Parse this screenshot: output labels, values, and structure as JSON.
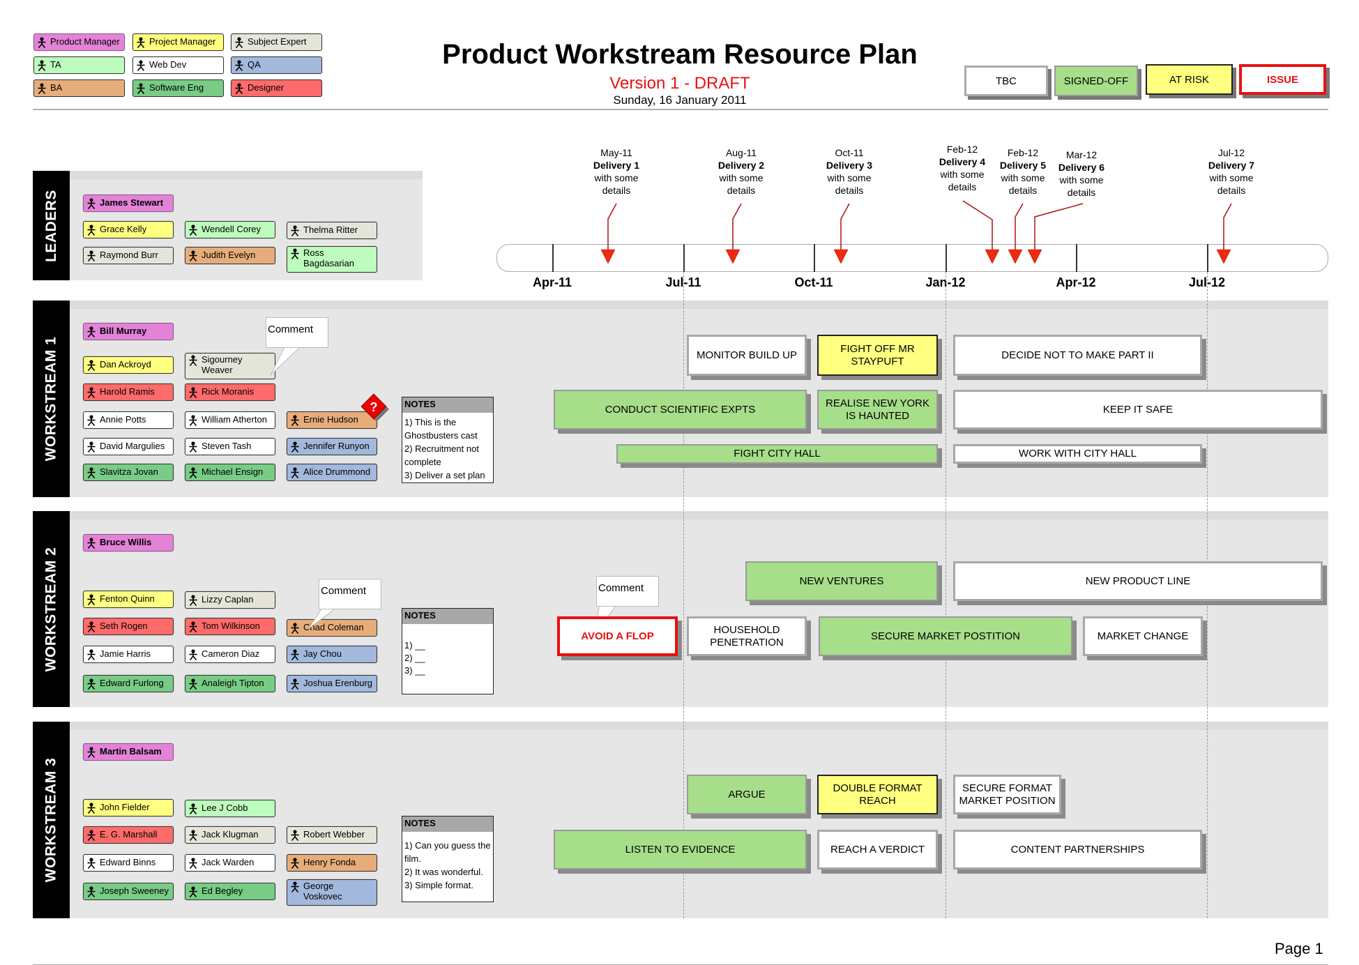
{
  "header": {
    "title": "Product Workstream Resource Plan",
    "version": "Version 1 - DRAFT",
    "date": "Sunday, 16 January 2011"
  },
  "role_legend": [
    {
      "label": "Product Manager",
      "role": "pm"
    },
    {
      "label": "Project Manager",
      "role": "prj"
    },
    {
      "label": "Subject Expert",
      "role": "sme"
    },
    {
      "label": "TA",
      "role": "ta"
    },
    {
      "label": "Web Dev",
      "role": "web"
    },
    {
      "label": "QA",
      "role": "qa"
    },
    {
      "label": "BA",
      "role": "ba"
    },
    {
      "label": "Software Eng",
      "role": "sw"
    },
    {
      "label": "Designer",
      "role": "des"
    }
  ],
  "status_legend": [
    {
      "label": "TBC",
      "status": "tbc"
    },
    {
      "label": "SIGNED-OFF",
      "status": "signed"
    },
    {
      "label": "AT RISK",
      "status": "risk"
    },
    {
      "label": "ISSUE",
      "status": "issue"
    }
  ],
  "timeline": {
    "ticks": [
      "Apr-11",
      "Jul-11",
      "Oct-11",
      "Jan-12",
      "Apr-12",
      "Jul-12"
    ],
    "milestones": [
      {
        "date": "May-11",
        "name": "Delivery 1",
        "detail": "with some details"
      },
      {
        "date": "Aug-11",
        "name": "Delivery 2",
        "detail": "with some details"
      },
      {
        "date": "Oct-11",
        "name": "Delivery 3",
        "detail": "with some details"
      },
      {
        "date": "Feb-12",
        "name": "Delivery 4",
        "detail": "with some details"
      },
      {
        "date": "Feb-12",
        "name": "Delivery 5",
        "detail": "with some details"
      },
      {
        "date": "Mar-12",
        "name": "Delivery 6",
        "detail": "with some details"
      },
      {
        "date": "Jul-12",
        "name": "Delivery 7",
        "detail": "with some details"
      }
    ]
  },
  "leaders": {
    "label": "LEADERS",
    "people": [
      {
        "name": "James Stewart",
        "role": "pm"
      },
      {
        "name": "Grace Kelly",
        "role": "prj"
      },
      {
        "name": "Wendell Corey",
        "role": "ta"
      },
      {
        "name": "Thelma Ritter",
        "role": "sme"
      },
      {
        "name": "Raymond Burr",
        "role": "sme"
      },
      {
        "name": "Judith Evelyn",
        "role": "ba"
      },
      {
        "name": "Ross Bagdasarian",
        "role": "ta"
      }
    ]
  },
  "workstreams": [
    {
      "label": "WORKSTREAM 1",
      "people": [
        {
          "name": "Bill Murray",
          "role": "pm"
        },
        {
          "name": "Dan Ackroyd",
          "role": "prj"
        },
        {
          "name": "Sigourney Weaver",
          "role": "sme"
        },
        {
          "name": "Harold Ramis",
          "role": "des"
        },
        {
          "name": "Rick Moranis",
          "role": "des"
        },
        {
          "name": "Annie Potts",
          "role": "web"
        },
        {
          "name": "William Atherton",
          "role": "web"
        },
        {
          "name": "Ernie Hudson",
          "role": "ba"
        },
        {
          "name": "David Margulies",
          "role": "web"
        },
        {
          "name": "Steven Tash",
          "role": "web"
        },
        {
          "name": "Jennifer Runyon",
          "role": "qa"
        },
        {
          "name": "Slavitza Jovan",
          "role": "sw"
        },
        {
          "name": "Michael Ensign",
          "role": "sw"
        },
        {
          "name": "Alice Drummond",
          "role": "qa"
        }
      ],
      "comment": "Comment",
      "flag": "?",
      "notes": {
        "title": "NOTES",
        "lines": [
          "1) This is the Ghostbusters cast",
          "2) Recruitment not complete",
          "3) Deliver a set plan"
        ]
      },
      "tasks": [
        {
          "label": "MONITOR BUILD UP",
          "status": "tbc"
        },
        {
          "label": "FIGHT OFF MR STAYPUFT",
          "status": "risk"
        },
        {
          "label": "DECIDE NOT TO MAKE PART II",
          "status": "tbc"
        },
        {
          "label": "CONDUCT SCIENTIFIC EXPTS",
          "status": "signed"
        },
        {
          "label": "REALISE NEW YORK IS HAUNTED",
          "status": "signed"
        },
        {
          "label": "KEEP IT SAFE",
          "status": "tbc"
        },
        {
          "label": "FIGHT CITY HALL",
          "status": "signed"
        },
        {
          "label": "WORK WITH CITY HALL",
          "status": "tbc"
        }
      ]
    },
    {
      "label": "WORKSTREAM 2",
      "people": [
        {
          "name": "Bruce Willis",
          "role": "pm"
        },
        {
          "name": "Fenton Quinn",
          "role": "prj"
        },
        {
          "name": "Lizzy Caplan",
          "role": "sme"
        },
        {
          "name": "Seth Rogen",
          "role": "des"
        },
        {
          "name": "Tom Wilkinson",
          "role": "des"
        },
        {
          "name": "Chad Coleman",
          "role": "ba"
        },
        {
          "name": "Jamie Harris",
          "role": "web"
        },
        {
          "name": "Cameron Diaz",
          "role": "web"
        },
        {
          "name": "Jay Chou",
          "role": "qa"
        },
        {
          "name": "Edward Furlong",
          "role": "sw"
        },
        {
          "name": "Analeigh Tipton",
          "role": "sw"
        },
        {
          "name": "Joshua Erenburg",
          "role": "qa"
        }
      ],
      "comment": "Comment",
      "task_comment": "Comment",
      "notes": {
        "title": "NOTES",
        "lines": [
          "1) __",
          "2) __",
          "3) __"
        ]
      },
      "tasks": [
        {
          "label": "NEW VENTURES",
          "status": "signed"
        },
        {
          "label": "NEW PRODUCT LINE",
          "status": "tbc"
        },
        {
          "label": "AVOID A FLOP",
          "status": "issue"
        },
        {
          "label": "HOUSEHOLD PENETRATION",
          "status": "tbc"
        },
        {
          "label": "SECURE MARKET POSTITION",
          "status": "signed"
        },
        {
          "label": "MARKET CHANGE",
          "status": "tbc"
        }
      ]
    },
    {
      "label": "WORKSTREAM 3",
      "people": [
        {
          "name": "Martin Balsam",
          "role": "pm"
        },
        {
          "name": "John Fielder",
          "role": "prj"
        },
        {
          "name": "Lee J Cobb",
          "role": "ta"
        },
        {
          "name": "E. G. Marshall",
          "role": "des"
        },
        {
          "name": "Jack Klugman",
          "role": "sme"
        },
        {
          "name": "Robert Webber",
          "role": "sme"
        },
        {
          "name": "Edward Binns",
          "role": "web"
        },
        {
          "name": "Jack Warden",
          "role": "web"
        },
        {
          "name": "Henry Fonda",
          "role": "ba"
        },
        {
          "name": "Joseph Sweeney",
          "role": "sw"
        },
        {
          "name": "Ed Begley",
          "role": "sw"
        },
        {
          "name": "George Voskovec",
          "role": "qa"
        }
      ],
      "notes": {
        "title": "NOTES",
        "lines": [
          "1) Can you guess the film.",
          "2) It was wonderful.",
          "3) Simple format."
        ]
      },
      "tasks": [
        {
          "label": "ARGUE",
          "status": "signed"
        },
        {
          "label": "DOUBLE FORMAT REACH",
          "status": "risk"
        },
        {
          "label": "SECURE FORMAT MARKET POSITION",
          "status": "tbc"
        },
        {
          "label": "LISTEN TO EVIDENCE",
          "status": "signed"
        },
        {
          "label": "REACH A VERDICT",
          "status": "tbc"
        },
        {
          "label": "CONTENT PARTNERSHIPS",
          "status": "tbc"
        }
      ]
    }
  ],
  "footer": {
    "page": "Page 1"
  }
}
